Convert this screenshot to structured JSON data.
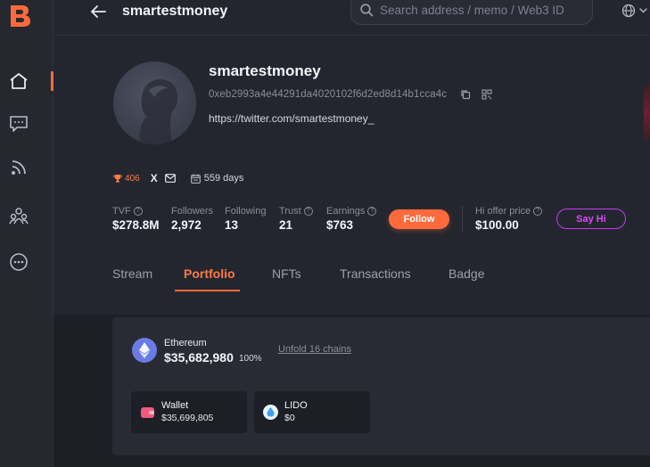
{
  "colors": {
    "accent": "#ff6a3d",
    "background": "#24262f",
    "sidebar": "#262830",
    "card": "#292b34",
    "sayhi": "#c43cf0",
    "ethereum": "#6a7ce4",
    "wallet_icon": "#f05a7e",
    "lido_icon": "#3aa1ef"
  },
  "sidebar": {
    "items": [
      {
        "icon": "home-icon",
        "active": true
      },
      {
        "icon": "chat-icon"
      },
      {
        "icon": "feed-icon"
      },
      {
        "icon": "community-icon"
      },
      {
        "icon": "more-icon"
      }
    ]
  },
  "header": {
    "title": "smartestmoney",
    "search_placeholder": "Search address / memo / Web3 ID"
  },
  "profile": {
    "name": "smartestmoney",
    "address": "0xeb2993a4e44291da4020102f6d2ed8d14b1cca4c",
    "twitter": "https://twitter.com/smartestmoney_",
    "trophy_count": "406",
    "x_label": "X",
    "days": "559 days"
  },
  "stats": [
    {
      "label": "TVF",
      "value": "$278.8M",
      "help": true
    },
    {
      "label": "Followers",
      "value": "2,972",
      "help": false
    },
    {
      "label": "Following",
      "value": "13",
      "help": false
    },
    {
      "label": "Trust",
      "value": "21",
      "help": true
    },
    {
      "label": "Earnings",
      "value": "$763",
      "help": true
    }
  ],
  "actions": {
    "follow": "Follow",
    "hi_offer_label": "Hi offer price",
    "hi_offer_value": "$100.00",
    "say_hi": "Say Hi"
  },
  "tabs": [
    {
      "label": "Stream"
    },
    {
      "label": "Portfolio",
      "active": true
    },
    {
      "label": "NFTs"
    },
    {
      "label": "Transactions"
    },
    {
      "label": "Badge"
    }
  ],
  "portfolio": {
    "chain": {
      "name": "Ethereum",
      "value": "$35,682,980",
      "percent": "100%"
    },
    "unfold": "Unfold 16 chains",
    "assets": [
      {
        "name": "Wallet",
        "value": "$35,699,805",
        "icon": "wallet-icon"
      },
      {
        "name": "LIDO",
        "value": "$0",
        "icon": "lido-icon"
      }
    ]
  }
}
